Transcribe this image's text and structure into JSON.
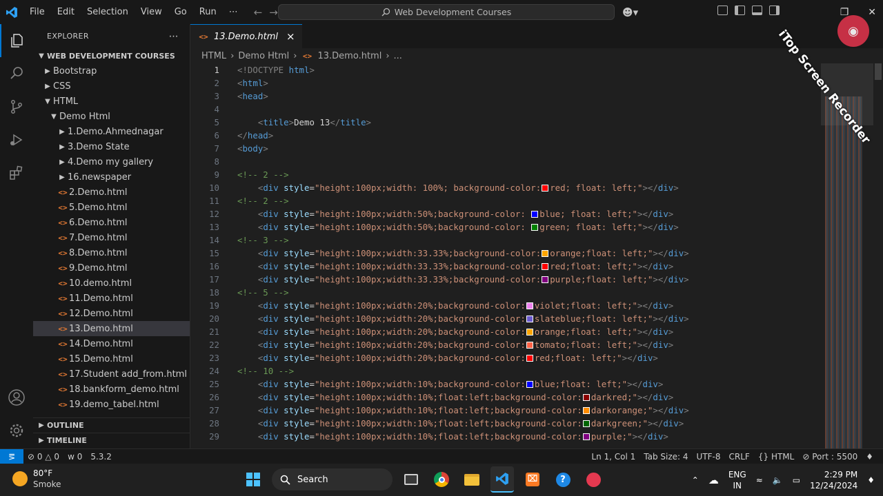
{
  "menu": [
    "File",
    "Edit",
    "Selection",
    "View",
    "Go",
    "Run",
    "⋯"
  ],
  "search": {
    "label": "Web Development Courses"
  },
  "watermark": "iTop Screen Recorder",
  "explorer": {
    "header": "EXPLORER",
    "more": "⋯",
    "root": "WEB DEVELOPMENT COURSES",
    "folders": [
      {
        "label": "Bootstrap",
        "open": false,
        "depth": 1
      },
      {
        "label": "CSS",
        "open": false,
        "depth": 1
      },
      {
        "label": "HTML",
        "open": true,
        "depth": 1
      },
      {
        "label": "Demo Html",
        "open": true,
        "depth": 2
      }
    ],
    "items": [
      {
        "label": "1.Demo.Ahmednagar",
        "type": "folder"
      },
      {
        "label": "3.Demo State",
        "type": "folder"
      },
      {
        "label": "4.Demo my gallery",
        "type": "folder"
      },
      {
        "label": "16.newspaper",
        "type": "folder"
      },
      {
        "label": "2.Demo.html",
        "type": "file"
      },
      {
        "label": "5.Demo.html",
        "type": "file"
      },
      {
        "label": "6.Demo.html",
        "type": "file"
      },
      {
        "label": "7.Demo.html",
        "type": "file"
      },
      {
        "label": "8.Demo.html",
        "type": "file"
      },
      {
        "label": "9.Demo.html",
        "type": "file"
      },
      {
        "label": "10.demo.html",
        "type": "file"
      },
      {
        "label": "11.Demo.html",
        "type": "file"
      },
      {
        "label": "12.Demo.html",
        "type": "file"
      },
      {
        "label": "13.Demo.html",
        "type": "file",
        "selected": true
      },
      {
        "label": "14.Demo.html",
        "type": "file"
      },
      {
        "label": "15.Demo.html",
        "type": "file"
      },
      {
        "label": "17.Student add_from.html",
        "type": "file"
      },
      {
        "label": "18.bankform_demo.html",
        "type": "file"
      },
      {
        "label": "19.demo_tabel.html",
        "type": "file"
      }
    ],
    "outline": "OUTLINE",
    "timeline": "TIMELINE"
  },
  "tab": {
    "label": "13.Demo.html",
    "close": "×"
  },
  "breadcrumb": [
    "HTML",
    "Demo Html",
    "13.Demo.html",
    "..."
  ],
  "code_lines": [
    {
      "n": "1",
      "kind": "doctype"
    },
    {
      "n": "2",
      "kind": "simple",
      "text": "<html>"
    },
    {
      "n": "3",
      "kind": "simple",
      "text": "<head>"
    },
    {
      "n": "4",
      "kind": "blank"
    },
    {
      "n": "5",
      "kind": "title",
      "text": "Demo 13"
    },
    {
      "n": "6",
      "kind": "simple",
      "text": "</head>"
    },
    {
      "n": "7",
      "kind": "simple",
      "text": "<body>"
    },
    {
      "n": "8",
      "kind": "blank"
    },
    {
      "n": "9",
      "kind": "comment",
      "text": "<!-- 2 -->"
    },
    {
      "n": "10",
      "kind": "div",
      "pre": "height:100px;width: 100%; background-color:",
      "color": "#ff0000",
      "post": "red; float: left;"
    },
    {
      "n": "11",
      "kind": "comment",
      "text": "<!-- 2 -->"
    },
    {
      "n": "12",
      "kind": "div",
      "pre": "height:100px;width:50%;background-color: ",
      "color": "#0000ff",
      "post": "blue; float: left;"
    },
    {
      "n": "13",
      "kind": "div",
      "pre": "height:100px;width:50%;background-color: ",
      "color": "#008000",
      "post": "green; float: left;"
    },
    {
      "n": "14",
      "kind": "comment",
      "text": "<!-- 3 -->"
    },
    {
      "n": "15",
      "kind": "div",
      "pre": "height:100px;width:33.33%;background-color:",
      "color": "#ffa500",
      "post": "orange;float: left;"
    },
    {
      "n": "16",
      "kind": "div",
      "pre": "height:100px;width:33.33%;background-color:",
      "color": "#ff0000",
      "post": "red;float: left;"
    },
    {
      "n": "17",
      "kind": "div",
      "pre": "height:100px;width:33.33%;background-color:",
      "color": "#800080",
      "post": "purple;float: left;"
    },
    {
      "n": "18",
      "kind": "comment",
      "text": "<!-- 5 -->"
    },
    {
      "n": "19",
      "kind": "div",
      "pre": "height:100px;width:20%;background-color:",
      "color": "#ee82ee",
      "post": "violet;float: left;"
    },
    {
      "n": "20",
      "kind": "div",
      "pre": "height:100px;width:20%;background-color:",
      "color": "#6a5acd",
      "post": "slateblue;float: left;"
    },
    {
      "n": "21",
      "kind": "div",
      "pre": "height:100px;width:20%;background-color:",
      "color": "#ffa500",
      "post": "orange;float: left;"
    },
    {
      "n": "22",
      "kind": "div",
      "pre": "height:100px;width:20%;background-color:",
      "color": "#ff6347",
      "post": "tomato;float: left;"
    },
    {
      "n": "23",
      "kind": "div",
      "pre": "height:100px;width:20%;background-color:",
      "color": "#ff0000",
      "post": "red;float: left;"
    },
    {
      "n": "24",
      "kind": "comment",
      "text": "<!-- 10 -->"
    },
    {
      "n": "25",
      "kind": "div",
      "pre": "height:100px;width:10%;background-color:",
      "color": "#0000ff",
      "post": "blue;float: left;"
    },
    {
      "n": "26",
      "kind": "div",
      "pre": "height:100px;width:10%;float:left;background-color:",
      "color": "#8b0000",
      "post": "darkred;"
    },
    {
      "n": "27",
      "kind": "div",
      "pre": "height:100px;width:10%;float:left;background-color:",
      "color": "#ff8c00",
      "post": "darkorange;"
    },
    {
      "n": "28",
      "kind": "div",
      "pre": "height:100px;width:10%;float:left;background-color:",
      "color": "#006400",
      "post": "darkgreen;"
    },
    {
      "n": "29",
      "kind": "div",
      "pre": "height:100px;width:10%;float:left;background-color:",
      "color": "#800080",
      "post": "purple;"
    }
  ],
  "status": {
    "remote": "⪚",
    "errors": "0",
    "warnings": "0",
    "ports_count": "0",
    "version": "5.3.2",
    "position": "Ln 1, Col 1",
    "tab_size": "Tab Size: 4",
    "encoding": "UTF-8",
    "eol": "CRLF",
    "language": "HTML",
    "port": "Port : 5500"
  },
  "taskbar": {
    "temp": "80°F",
    "condition": "Smoke",
    "search": "Search",
    "lang_top": "ENG",
    "lang_bottom": "IN",
    "time": "2:29 PM",
    "date": "12/24/2024"
  },
  "colors": {
    "accent": "#0078d4",
    "tag": "#569cd6",
    "attr": "#9cdcfe",
    "string": "#ce9178",
    "comment": "#6a9955"
  }
}
